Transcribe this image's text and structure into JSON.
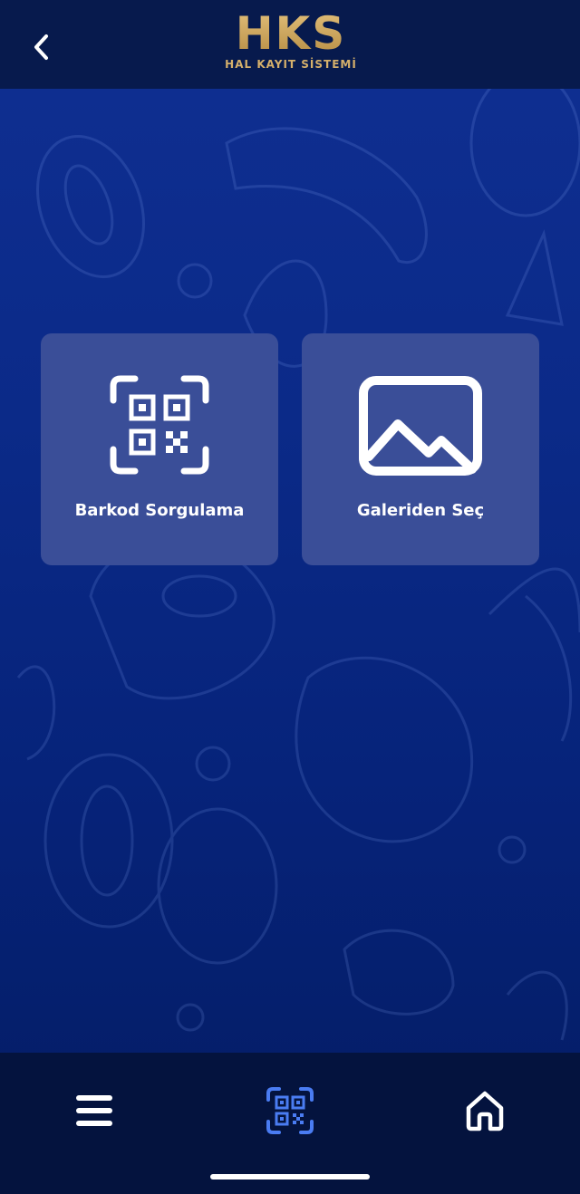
{
  "app": {
    "logo_title": "HKS",
    "logo_subtitle": "HAL KAYIT SİSTEMİ",
    "back_icon": "chevron-left-icon"
  },
  "main": {
    "cards": [
      {
        "label": "Barkod Sorgulama",
        "icon": "qr-scan-icon"
      },
      {
        "label": "Galeriden Seç",
        "icon": "image-gallery-icon"
      }
    ]
  },
  "bottom_nav": {
    "items": [
      {
        "icon": "menu-icon",
        "active": false
      },
      {
        "icon": "qr-code-icon",
        "active": true
      },
      {
        "icon": "home-icon",
        "active": false
      }
    ]
  },
  "colors": {
    "header_bg": "#071a4d",
    "background": "#0b2a88",
    "card_bg": "#3a4e98",
    "logo_gold": "#c9a35c",
    "nav_bg": "#04133e",
    "nav_active": "#4a7cf2",
    "text": "#ffffff"
  }
}
